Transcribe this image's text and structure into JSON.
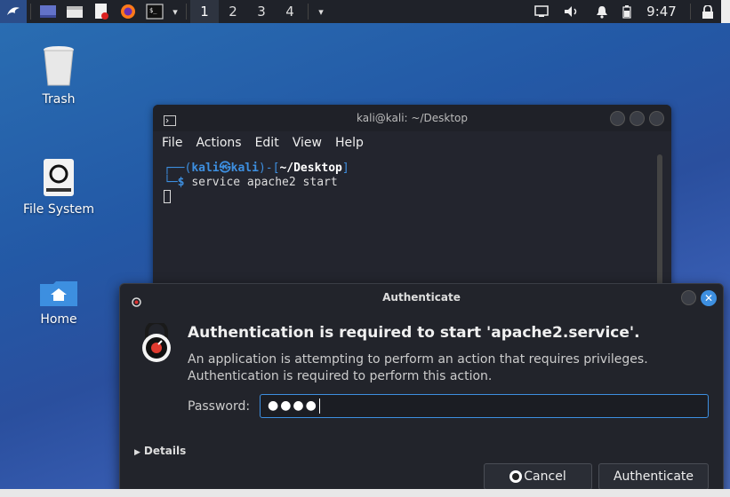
{
  "panel": {
    "workspaces": [
      "1",
      "2",
      "3",
      "4"
    ],
    "active_workspace": "1",
    "clock": "9:47"
  },
  "desktop": {
    "icons": [
      {
        "label": "Trash"
      },
      {
        "label": "File System"
      },
      {
        "label": "Home"
      }
    ]
  },
  "terminal": {
    "title": "kali@kali: ~/Desktop",
    "menu": [
      "File",
      "Actions",
      "Edit",
      "View",
      "Help"
    ],
    "prompt_user": "kali",
    "prompt_host": "kali",
    "prompt_path": "~/Desktop",
    "command": "service apache2 start"
  },
  "dialog": {
    "title": "Authenticate",
    "heading": "Authentication is required to start 'apache2.service'.",
    "description": "An application is attempting to perform an action that requires privileges. Authentication is required to perform this action.",
    "password_label": "Password:",
    "password_value": "●●●●",
    "details_label": "Details",
    "cancel_label": "Cancel",
    "authenticate_label": "Authenticate"
  },
  "colors": {
    "accent": "#3d8fe0",
    "panel": "#1f2229",
    "terminal_bg": "#23252e"
  }
}
